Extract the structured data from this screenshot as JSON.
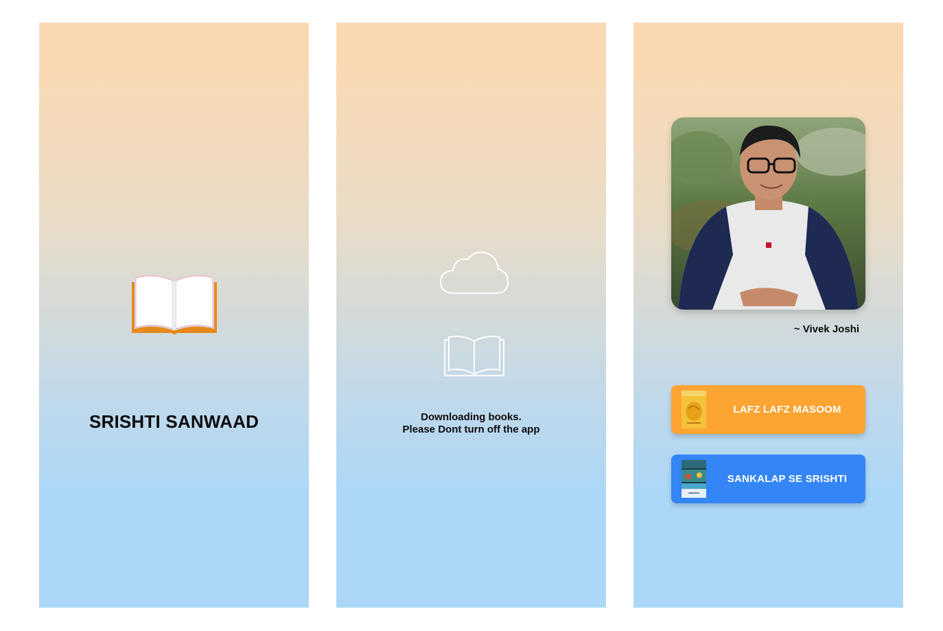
{
  "screens": [
    {
      "id": "splash",
      "title": "SRISHTI SANWAAD",
      "icon": "open-book-icon"
    },
    {
      "id": "downloading",
      "icons": [
        "cloud-icon",
        "open-book-outline-icon"
      ],
      "message_line1": "Downloading books.",
      "message_line2": "Please Dont turn off the app"
    },
    {
      "id": "author",
      "author_name": "~ Vivek Joshi",
      "books": [
        {
          "label": "LAFZ LAFZ MASOOM",
          "color": "#fda432"
        },
        {
          "label": "SANKALAP SE SRISHTI",
          "color": "#3485f6"
        }
      ]
    }
  ],
  "colors": {
    "gradient_top": "#fad9b2",
    "gradient_bottom": "#acd8f8",
    "book_orange": "#e8891c"
  }
}
